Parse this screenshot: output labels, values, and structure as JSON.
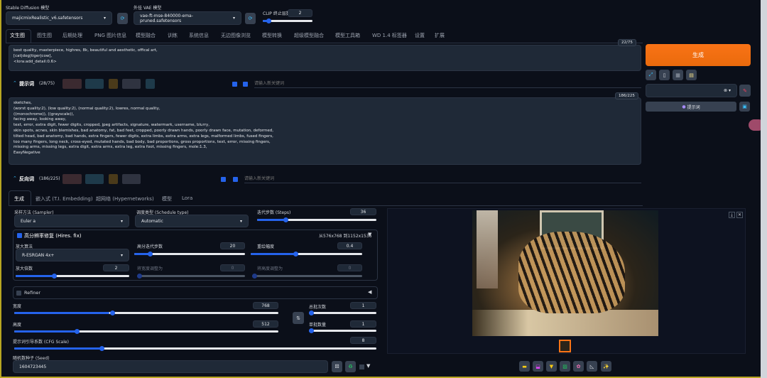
{
  "header": {
    "sd_model_label": "Stable Diffusion 模型",
    "sd_model": "majicmixRealistic_v6.safetensors",
    "vae_label": "外挂 VAE 模型",
    "vae": "vae-ft-mse-840000-ema-pruned.safetensors",
    "clip_label": "CLIP 终止层数",
    "clip_value": "2"
  },
  "tabs": [
    "文生图",
    "图生图",
    "后期处理",
    "PNG 图片信息",
    "模型融合",
    "训练",
    "系统信息",
    "无边图像浏览",
    "模型转换",
    "超级模型融合",
    "模型工具箱",
    "WD 1.4 标签器",
    "设置",
    "扩展"
  ],
  "prompt": {
    "text": "best quality, masterpiece, highres, 8k, beautiful and aesthetic, offical art,\n[cat|dog|tiger|cow],\n<lora:add_detail:0.6>",
    "counter": "22/75",
    "label": "提示词",
    "count": "(28/75)",
    "keyword_placeholder": "请输入新关键词"
  },
  "negative": {
    "text": "sketches,\n(worst quality:2), (low quality:2), (normal quality:2), lowres, normal quality,\n((monochrome)), ((grayscale)),\nfacing away, looking away,\ntext, error, extra digit, fewer digits, cropped, jpeg artifacts, signature, watermark, username, blurry,\nskin spots, acnes, skin blemishes, bad anatomy, fat, bad feet, cropped, poorly drawn hands, poorly drawn face, mutation, deformed,\ntilted head, bad anatomy, bad hands, extra fingers, fewer digits, extra limbs, extra arms, extra legs, malformed limbs, fused fingers,\ntoo many fingers, long neck, cross-eyed, mutated hands, bad body, bad proportions, gross proportions, text, error, missing fingers,\nmissing arms, missing legs, extra digit, extra arms, extra leg, extra foot, missing fingers, mole:1.3,\nEasyNegative",
    "counter": "186/225",
    "label": "反向词",
    "count": "(186/225)",
    "keyword_placeholder": "请输入新关键词"
  },
  "right": {
    "generate": "生成",
    "prompt_btn": "提示词"
  },
  "subtabs": [
    "生成",
    "嵌入式 (T.I. Embedding)",
    "超网络 (Hypernetworks)",
    "模型",
    "Lora"
  ],
  "settings": {
    "sampler_label": "采样方法 (Sampler)",
    "sampler": "Euler a",
    "schedule_label": "调度类型 (Schedule type)",
    "schedule": "Automatic",
    "steps_label": "迭代步数 (Steps)",
    "steps": "36",
    "hires_label": "高分辨率修复 (Hires. fix)",
    "hires_info": "从576x768 到1152x1536",
    "upscaler_label": "放大算法",
    "upscaler": "R-ESRGAN 4x+",
    "hires_steps_label": "高分迭代步数",
    "hires_steps": "20",
    "denoise_label": "重绘幅度",
    "denoise": "0.4",
    "upscale_label": "放大倍数",
    "upscale": "2",
    "resize_w_label": "将宽度调整为",
    "resize_w": "0",
    "resize_h_label": "将高度调整为",
    "resize_h": "0",
    "refiner_label": "Refiner",
    "width_label": "宽度",
    "width": "768",
    "height_label": "高度",
    "height": "512",
    "batch_count_label": "总批次数",
    "batch_count": "1",
    "batch_size_label": "单批数量",
    "batch_size": "1",
    "cfg_label": "提示词引导系数 (CFG Scale)",
    "cfg": "8",
    "seed_label": "随机数种子 (Seed)",
    "seed": "1604723445"
  },
  "colors": {
    "accent": "#2563eb",
    "generate": "#f97316",
    "background": "#0b0f19"
  }
}
